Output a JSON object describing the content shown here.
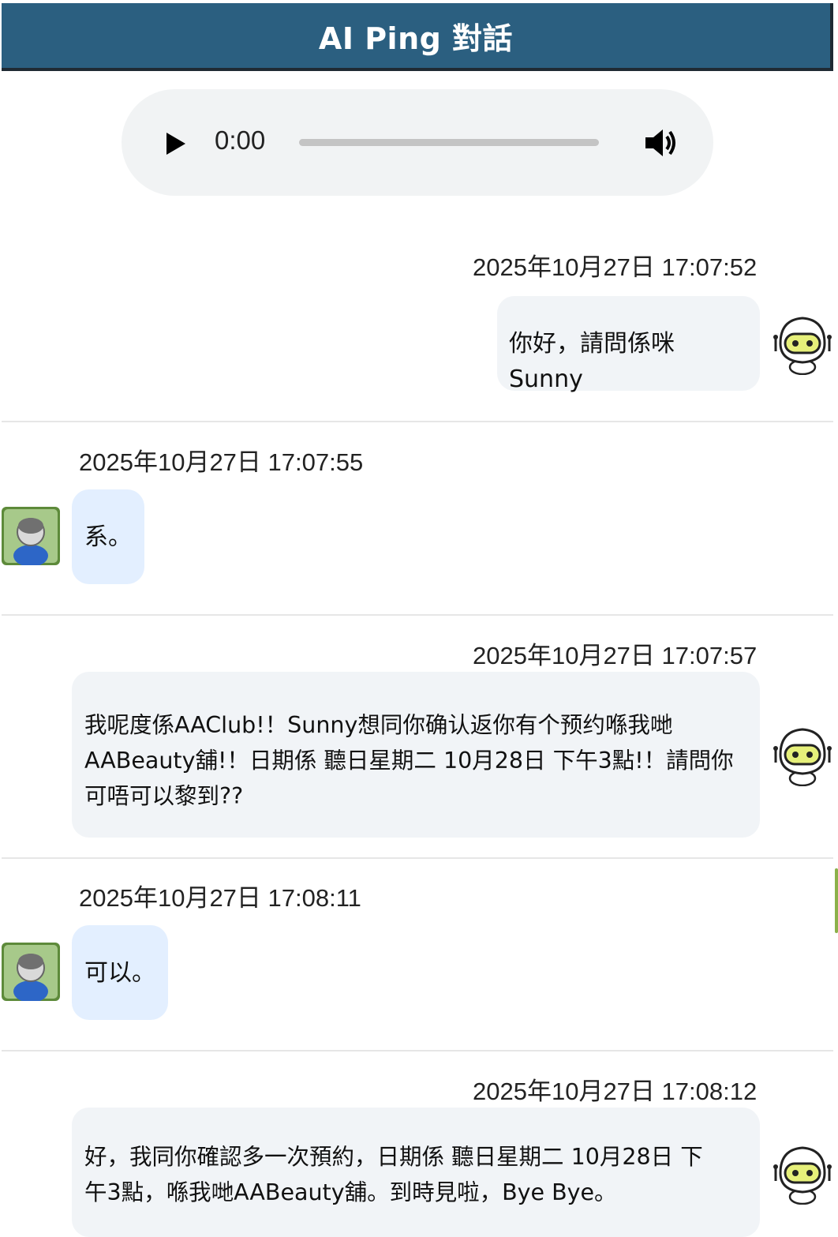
{
  "header": {
    "title": "AI Ping 對話"
  },
  "audio": {
    "time": "0:00",
    "progress": 0,
    "play_icon": "play-icon",
    "volume_icon": "volume-icon"
  },
  "messages": [
    {
      "role": "bot",
      "timestamp": "2025年10月27日 17:07:52",
      "text": "你好，請問係咪Sunny"
    },
    {
      "role": "user",
      "timestamp": "2025年10月27日 17:07:55",
      "text": "系。"
    },
    {
      "role": "bot",
      "timestamp": "2025年10月27日 17:07:57",
      "lines": [
        "我呢度係AAClub!！Sunny想同你确认返你有个预约喺我哋",
        "AABeauty舖!！日期係 聽日星期二 10月28日 下午3點!！請問你",
        "可唔可以黎到??"
      ]
    },
    {
      "role": "user",
      "timestamp": "2025年10月27日 17:08:11",
      "text": "可以。"
    },
    {
      "role": "bot",
      "timestamp": "2025年10月27日 17:08:12",
      "lines": [
        "好，我同你確認多一次預約，日期係 聽日星期二 10月28日 下",
        "午3點，喺我哋AABeauty舖。到時見啦，Bye Bye。"
      ]
    }
  ],
  "colors": {
    "header_bg": "#2b5f80",
    "bot_bubble": "#f1f4f7",
    "user_bubble": "#e3efff"
  }
}
